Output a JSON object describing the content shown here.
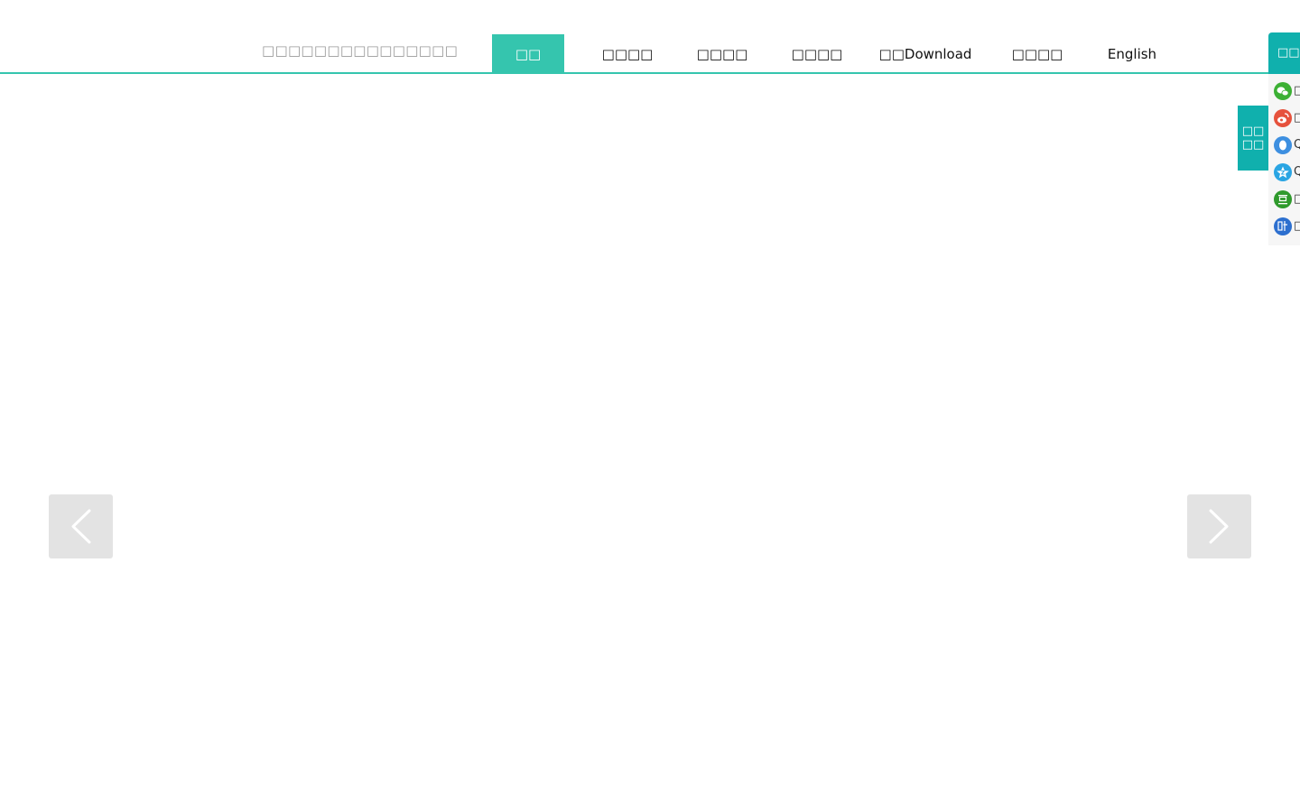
{
  "header": {
    "tagline": "□□□□□□□□□□□□□□□"
  },
  "nav": {
    "items": [
      {
        "label": "□□",
        "active": true
      },
      {
        "label": "□□□□",
        "active": false
      },
      {
        "label": "□□□□",
        "active": false
      },
      {
        "label": "□□□□",
        "active": false
      },
      {
        "label": "□□Download",
        "active": false
      },
      {
        "label": "□□□□",
        "active": false
      },
      {
        "label": "English",
        "active": false
      }
    ]
  },
  "slider": {
    "prev_icon": "chevron-left-icon",
    "next_icon": "chevron-right-icon"
  },
  "share_tab": {
    "line1": "□□",
    "line2": "□□"
  },
  "share_panel": {
    "title": "□□□",
    "items": [
      {
        "icon": "wechat-icon",
        "color": "#3cb034",
        "label": "□"
      },
      {
        "icon": "weibo-icon",
        "color": "#e6523d",
        "label": "□"
      },
      {
        "icon": "qq-icon",
        "color": "#3d8fe0",
        "label": "Q"
      },
      {
        "icon": "qzone-icon",
        "color": "#2aa5e3",
        "label": "Q"
      },
      {
        "icon": "douban-icon",
        "color": "#2f9a2c",
        "label": "□"
      },
      {
        "icon": "tieba-icon",
        "color": "#2c6fcf",
        "label": "□"
      }
    ]
  },
  "colors": {
    "accent": "#35c5ae",
    "share_accent": "#10b0ad",
    "arrow_bg": "#e3e3e3"
  }
}
